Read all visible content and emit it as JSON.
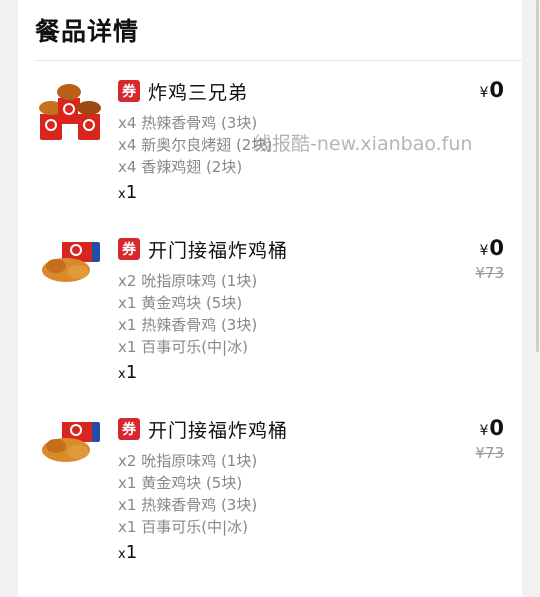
{
  "section_title": "餐品详情",
  "items": [
    {
      "icon": "fried-chicken-buckets-image",
      "coupon": "券",
      "name": "炸鸡三兄弟",
      "price_symbol": "¥",
      "price": "0",
      "original_price": "",
      "components": [
        "x4 热辣香骨鸡 (3块)",
        "x4 新奥尔良烤翅 (2块)",
        "x4 香辣鸡翅 (2块)"
      ],
      "qty_prefix": "x",
      "qty": "1"
    },
    {
      "icon": "chicken-bucket-meal-image",
      "coupon": "券",
      "name": "开门接福炸鸡桶",
      "price_symbol": "¥",
      "price": "0",
      "original_price": "¥73",
      "components": [
        "x2 吮指原味鸡 (1块)",
        "x1 黄金鸡块 (5块)",
        "x1 热辣香骨鸡 (3块)",
        "x1 百事可乐(中|冰)"
      ],
      "qty_prefix": "x",
      "qty": "1"
    },
    {
      "icon": "chicken-bucket-meal-image",
      "coupon": "券",
      "name": "开门接福炸鸡桶",
      "price_symbol": "¥",
      "price": "0",
      "original_price": "¥73",
      "components": [
        "x2 吮指原味鸡 (1块)",
        "x1 黄金鸡块 (5块)",
        "x1 热辣香骨鸡 (3块)",
        "x1 百事可乐(中|冰)"
      ],
      "qty_prefix": "x",
      "qty": "1"
    }
  ],
  "watermark": "线报酷-new.xianbao.fun",
  "colors": {
    "coupon_red": "#d7282f",
    "muted_text": "#888888",
    "strike_text": "#999999"
  }
}
